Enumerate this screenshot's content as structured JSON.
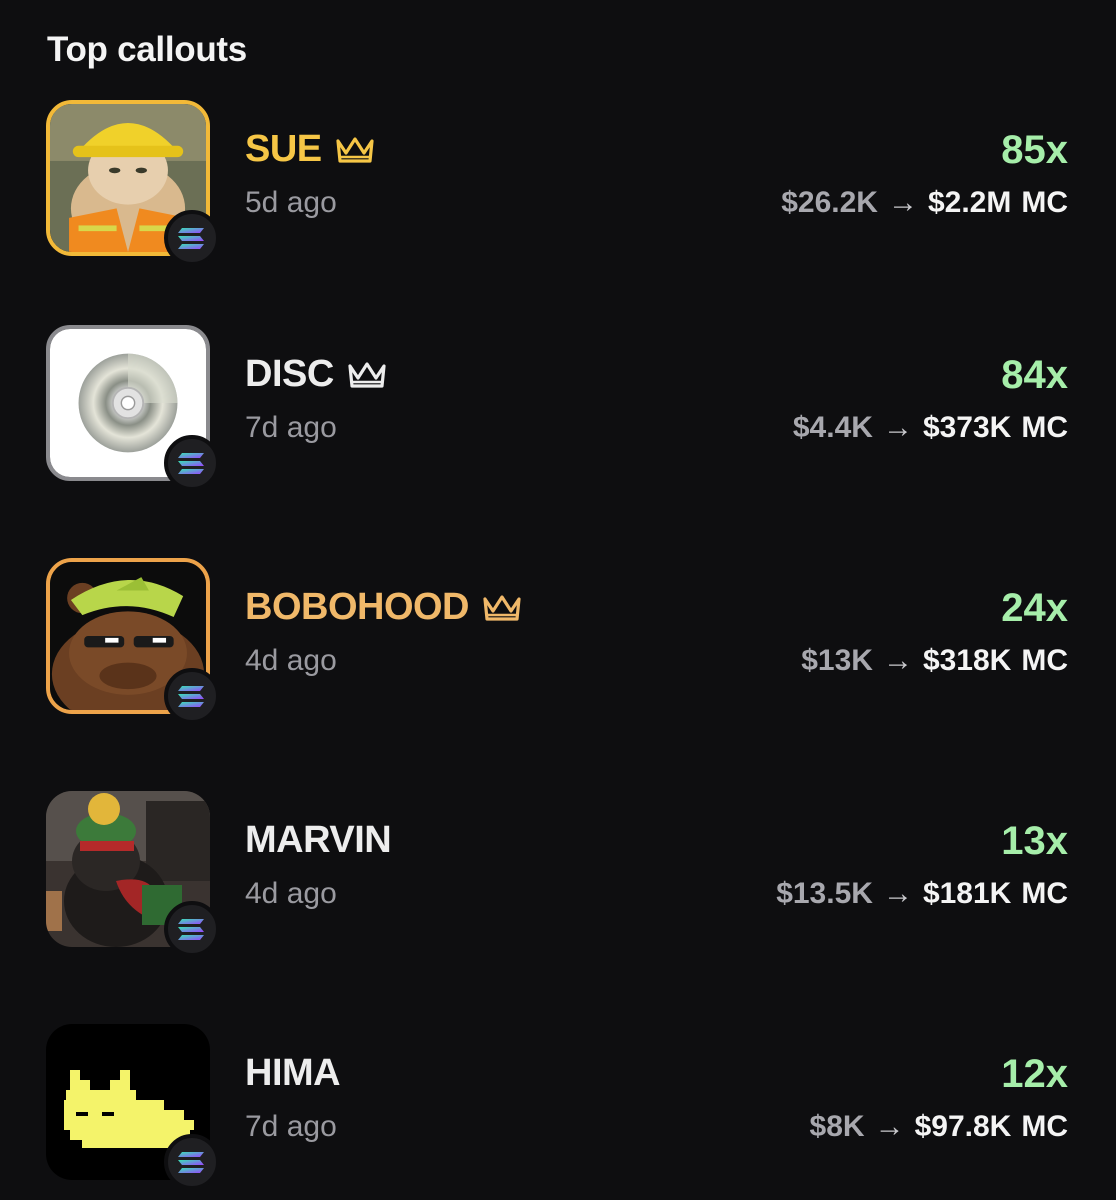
{
  "header": {
    "title": "Top callouts"
  },
  "callouts": [
    {
      "name": "SUE",
      "crowned": true,
      "name_color": "#f6c646",
      "frame_color": "#f2b938",
      "time": "5d ago",
      "multiplier": "85x",
      "mc_from": "$26.2K",
      "arrow": "→",
      "mc_to": "$2.2M",
      "unit": "MC",
      "avatar_icon": "cat-hardhat-avatar"
    },
    {
      "name": "DISC",
      "crowned": true,
      "name_color": "#ededed",
      "frame_color": "#8a8a8e",
      "time": "7d ago",
      "multiplier": "84x",
      "mc_from": "$4.4K",
      "arrow": "→",
      "mc_to": "$373K",
      "unit": "MC",
      "avatar_icon": "cd-disc-avatar"
    },
    {
      "name": "BOBOHOOD",
      "crowned": true,
      "name_color": "#f0b869",
      "frame_color": "#eda34a",
      "time": "4d ago",
      "multiplier": "24x",
      "mc_from": "$13K",
      "arrow": "→",
      "mc_to": "$318K",
      "unit": "MC",
      "avatar_icon": "frog-bear-avatar"
    },
    {
      "name": "MARVIN",
      "crowned": false,
      "name_color": "#ededed",
      "frame_color": "none",
      "time": "4d ago",
      "multiplier": "13x",
      "mc_from": "$13.5K",
      "arrow": "→",
      "mc_to": "$181K",
      "unit": "MC",
      "avatar_icon": "dog-beanie-avatar"
    },
    {
      "name": "HIMA",
      "crowned": false,
      "name_color": "#ededed",
      "frame_color": "none",
      "time": "7d ago",
      "multiplier": "12x",
      "mc_from": "$8K",
      "arrow": "→",
      "mc_to": "$97.8K",
      "unit": "MC",
      "avatar_icon": "pixel-cat-avatar"
    }
  ],
  "colors": {
    "background": "#0e0e10",
    "multiplier": "#a6eeaa",
    "muted": "#9a9aa0"
  },
  "chain_icon": "solana-icon"
}
